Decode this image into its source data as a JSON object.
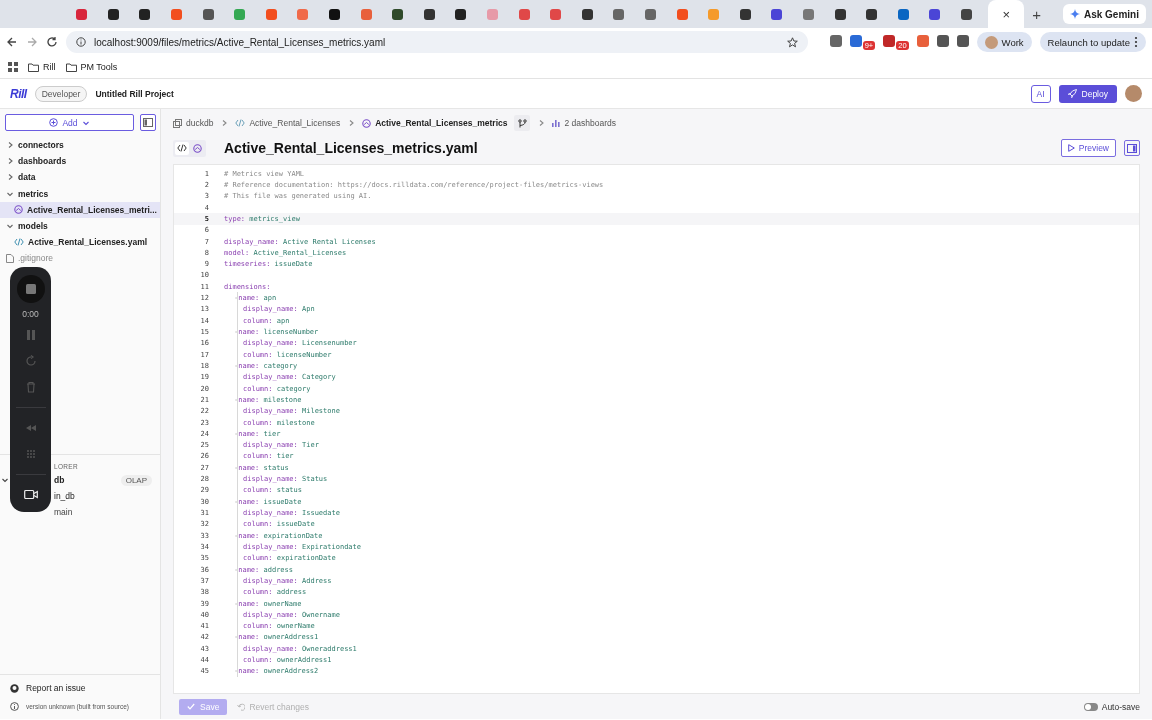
{
  "browser": {
    "tabs": [
      {
        "selected": false,
        "color": "#d8263c"
      },
      {
        "selected": false,
        "color": "#222222"
      },
      {
        "selected": false,
        "color": "#222222"
      },
      {
        "selected": false,
        "color": "#f24e1e"
      },
      {
        "selected": false,
        "color": "#555555"
      },
      {
        "selected": false,
        "color": "#34a853"
      },
      {
        "selected": false,
        "color": "#f24e1e"
      },
      {
        "selected": false,
        "color": "#f06a4a"
      },
      {
        "selected": false,
        "color": "#111111"
      },
      {
        "selected": false,
        "color": "#e8603c"
      },
      {
        "selected": false,
        "color": "#2f4a2a"
      },
      {
        "selected": false,
        "color": "#333333"
      },
      {
        "selected": false,
        "color": "#222222"
      },
      {
        "selected": false,
        "color": "#e79aa8"
      },
      {
        "selected": false,
        "color": "#e04848"
      },
      {
        "selected": false,
        "color": "#e04848"
      },
      {
        "selected": false,
        "color": "#333333"
      },
      {
        "selected": false,
        "color": "#666666"
      },
      {
        "selected": false,
        "color": "#666666"
      },
      {
        "selected": false,
        "color": "#f24e1e"
      },
      {
        "selected": false,
        "color": "#f59a2a"
      },
      {
        "selected": false,
        "color": "#333333"
      },
      {
        "selected": false,
        "color": "#4b45d6"
      },
      {
        "selected": false,
        "color": "#777777"
      },
      {
        "selected": false,
        "color": "#333333"
      },
      {
        "selected": false,
        "color": "#333333"
      },
      {
        "selected": false,
        "color": "#0a66c2"
      },
      {
        "selected": false,
        "color": "#4b45d6"
      },
      {
        "selected": false,
        "color": "#444444"
      },
      {
        "selected": true,
        "close": "×"
      }
    ],
    "new_tab": "+",
    "gemini": "Ask Gemini",
    "url": "localhost:9009/files/metrics/Active_Rental_Licenses_metrics.yaml",
    "extensions": [
      {
        "color": "#666666"
      },
      {
        "color": "#2a6ad6",
        "badge": "9+"
      },
      {
        "color": "#c02828",
        "badge": "20"
      },
      {
        "color": "#e8603c"
      },
      {
        "color": "#555555"
      },
      {
        "color": "#555555"
      }
    ],
    "profile": "Work",
    "relaunch": "Relaunch to update",
    "bookmarks": [
      {
        "label": "Rill"
      },
      {
        "label": "PM Tools"
      }
    ]
  },
  "app": {
    "logo": "Rill",
    "badge": "Developer",
    "project": "Untitled Rill Project",
    "ai": "AI",
    "deploy": "Deploy"
  },
  "sidebar": {
    "add": "Add",
    "tree": [
      {
        "label": "connectors",
        "kind": "folder",
        "expanded": false,
        "selected": false
      },
      {
        "label": "dashboards",
        "kind": "folder",
        "expanded": false,
        "selected": false
      },
      {
        "label": "data",
        "kind": "folder",
        "expanded": false,
        "selected": false
      },
      {
        "label": "metrics",
        "kind": "folder",
        "expanded": true,
        "selected": false,
        "children": [
          {
            "label": "Active_Rental_Licenses_metri...",
            "kind": "metrics",
            "selected": true
          }
        ]
      },
      {
        "label": "models",
        "kind": "folder",
        "expanded": true,
        "selected": false,
        "children": [
          {
            "label": "Active_Rental_Licenses.yaml",
            "kind": "model",
            "selected": false
          }
        ]
      },
      {
        "label": ".gitignore",
        "kind": "file",
        "selected": false
      }
    ],
    "explorer": {
      "heading": "LORER",
      "items": [
        {
          "label": "db",
          "tag": "OLAP",
          "expanded": true,
          "children": [
            {
              "label": "in_db",
              "expanded": true,
              "children": [
                {
                  "label": "main",
                  "expanded": false
                }
              ]
            }
          ]
        }
      ]
    },
    "recorder": {
      "time": "0:00"
    },
    "report": "Report an issue",
    "version": "version unknown (built from source)"
  },
  "main": {
    "breadcrumbs": [
      {
        "label": "duckdb",
        "kind": "connector",
        "current": false
      },
      {
        "label": "Active_Rental_Licenses",
        "kind": "model",
        "current": false
      },
      {
        "label": "Active_Rental_Licenses_metrics",
        "kind": "metrics",
        "current": true
      },
      {
        "label": "2 dashboards",
        "kind": "dashboards",
        "current": false
      }
    ],
    "view_modes": [
      {
        "kind": "code",
        "selected": true
      },
      {
        "kind": "metrics",
        "selected": false
      }
    ],
    "title": "Active_Rental_Licenses_metrics.yaml",
    "preview": "Preview",
    "lines": [
      {
        "n": "1",
        "kind": "comment",
        "text": "# Metrics view YAML",
        "current": false
      },
      {
        "n": "2",
        "kind": "comment",
        "text": "# Reference documentation: https://docs.rilldata.com/reference/project-files/metrics-views",
        "current": false
      },
      {
        "n": "3",
        "kind": "comment",
        "text": "# This file was generated using AI.",
        "current": false
      },
      {
        "n": "4",
        "kind": "blank",
        "current": false
      },
      {
        "n": "5",
        "kind": "pair",
        "key": "type:",
        "value": "metrics_view",
        "current": true
      },
      {
        "n": "6",
        "kind": "blank",
        "current": false
      },
      {
        "n": "7",
        "kind": "pair",
        "key": "display_name:",
        "value": "Active Rental Licenses",
        "current": false
      },
      {
        "n": "8",
        "kind": "pair",
        "key": "model:",
        "value": "Active_Rental_Licenses",
        "current": false
      },
      {
        "n": "9",
        "kind": "pair",
        "key": "timeseries:",
        "value": "issueDate",
        "current": false
      },
      {
        "n": "10",
        "kind": "blank",
        "current": false
      },
      {
        "n": "11",
        "kind": "pair",
        "key": "dimensions:",
        "current": false
      },
      {
        "n": "12",
        "kind": "item",
        "dash": "-",
        "key": "name:",
        "value": "apn",
        "current": false
      },
      {
        "n": "13",
        "kind": "nested",
        "key": "display_name:",
        "value": "Apn",
        "current": false
      },
      {
        "n": "14",
        "kind": "nested",
        "key": "column:",
        "value": "apn",
        "current": false
      },
      {
        "n": "15",
        "kind": "item",
        "dash": "-",
        "key": "name:",
        "value": "licenseNumber",
        "current": false
      },
      {
        "n": "16",
        "kind": "nested",
        "key": "display_name:",
        "value": "Licensenumber",
        "current": false
      },
      {
        "n": "17",
        "kind": "nested",
        "key": "column:",
        "value": "licenseNumber",
        "current": false
      },
      {
        "n": "18",
        "kind": "item",
        "dash": "-",
        "key": "name:",
        "value": "category",
        "current": false
      },
      {
        "n": "19",
        "kind": "nested",
        "key": "display_name:",
        "value": "Category",
        "current": false
      },
      {
        "n": "20",
        "kind": "nested",
        "key": "column:",
        "value": "category",
        "current": false
      },
      {
        "n": "21",
        "kind": "item",
        "dash": "-",
        "key": "name:",
        "value": "milestone",
        "current": false
      },
      {
        "n": "22",
        "kind": "nested",
        "key": "display_name:",
        "value": "Milestone",
        "current": false
      },
      {
        "n": "23",
        "kind": "nested",
        "key": "column:",
        "value": "milestone",
        "current": false
      },
      {
        "n": "24",
        "kind": "item",
        "dash": "-",
        "key": "name:",
        "value": "tier",
        "current": false
      },
      {
        "n": "25",
        "kind": "nested",
        "key": "display_name:",
        "value": "Tier",
        "current": false
      },
      {
        "n": "26",
        "kind": "nested",
        "key": "column:",
        "value": "tier",
        "current": false
      },
      {
        "n": "27",
        "kind": "item",
        "dash": "-",
        "key": "name:",
        "value": "status",
        "current": false
      },
      {
        "n": "28",
        "kind": "nested",
        "key": "display_name:",
        "value": "Status",
        "current": false
      },
      {
        "n": "29",
        "kind": "nested",
        "key": "column:",
        "value": "status",
        "current": false
      },
      {
        "n": "30",
        "kind": "item",
        "dash": "-",
        "key": "name:",
        "value": "issueDate",
        "current": false
      },
      {
        "n": "31",
        "kind": "nested",
        "key": "display_name:",
        "value": "Issuedate",
        "current": false
      },
      {
        "n": "32",
        "kind": "nested",
        "key": "column:",
        "value": "issueDate",
        "current": false
      },
      {
        "n": "33",
        "kind": "item",
        "dash": "-",
        "key": "name:",
        "value": "expirationDate",
        "current": false
      },
      {
        "n": "34",
        "kind": "nested",
        "key": "display_name:",
        "value": "Expirationdate",
        "current": false
      },
      {
        "n": "35",
        "kind": "nested",
        "key": "column:",
        "value": "expirationDate",
        "current": false
      },
      {
        "n": "36",
        "kind": "item",
        "dash": "-",
        "key": "name:",
        "value": "address",
        "current": false
      },
      {
        "n": "37",
        "kind": "nested",
        "key": "display_name:",
        "value": "Address",
        "current": false
      },
      {
        "n": "38",
        "kind": "nested",
        "key": "column:",
        "value": "address",
        "current": false
      },
      {
        "n": "39",
        "kind": "item",
        "dash": "-",
        "key": "name:",
        "value": "ownerName",
        "current": false
      },
      {
        "n": "40",
        "kind": "nested",
        "key": "display_name:",
        "value": "Ownername",
        "current": false
      },
      {
        "n": "41",
        "kind": "nested",
        "key": "column:",
        "value": "ownerName",
        "current": false
      },
      {
        "n": "42",
        "kind": "item",
        "dash": "-",
        "key": "name:",
        "value": "ownerAddress1",
        "current": false
      },
      {
        "n": "43",
        "kind": "nested",
        "key": "display_name:",
        "value": "Owneraddress1",
        "current": false
      },
      {
        "n": "44",
        "kind": "nested",
        "key": "column:",
        "value": "ownerAddress1",
        "current": false
      },
      {
        "n": "45",
        "kind": "item",
        "dash": "-",
        "key": "name:",
        "value": "ownerAddress2",
        "current": false
      }
    ],
    "save": "Save",
    "revert": "Revert changes",
    "autosave": {
      "label": "Auto-save",
      "on": false
    }
  }
}
